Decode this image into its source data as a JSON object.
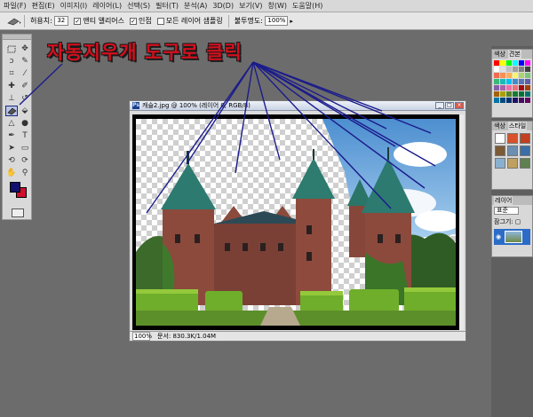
{
  "menu": [
    "파일(F)",
    "편집(E)",
    "이미지(I)",
    "레이어(L)",
    "선택(S)",
    "필터(T)",
    "분석(A)",
    "3D(D)",
    "보기(V)",
    "창(W)",
    "도움말(H)"
  ],
  "options": {
    "tolerance_label": "허용치:",
    "tolerance_value": "32",
    "antialias_label": "앤티 앨리어스",
    "contiguous_label": "인접",
    "sample_all_label": "모든 레이어 샘플링",
    "opacity_label": "불투명도:",
    "opacity_value": "100%"
  },
  "document": {
    "title": "캐슬2.jpg @ 100% (레이어 0, RGB/8)",
    "zoom": "100%",
    "doc_size": "문서: 830.3K/1.04M"
  },
  "panels": {
    "swatches": {
      "tabs": [
        "색상",
        "견본"
      ]
    },
    "styles": {
      "tabs": [
        "색상",
        "스타일"
      ]
    },
    "layers": {
      "tabs": [
        "레이어"
      ],
      "blend_mode": "표준",
      "lock_label": "잠그기:",
      "layer_name": "레이어 0"
    }
  },
  "annotation": {
    "text": "자동지우개 도구로 클릭"
  },
  "icons": {
    "magic-eraser": "magic-eraser-icon",
    "move": "move-icon",
    "marquee": "marquee-icon",
    "lasso": "lasso-icon",
    "crop": "crop-icon",
    "brush": "brush-icon",
    "pen": "pen-icon",
    "type": "type-icon",
    "zoom": "zoom-icon",
    "hand": "hand-icon"
  },
  "colors": {
    "annotation_text": "#d2101e",
    "callout_lines": "#1b1b8c",
    "foreground": "#12106e",
    "background": "#d0102c"
  }
}
